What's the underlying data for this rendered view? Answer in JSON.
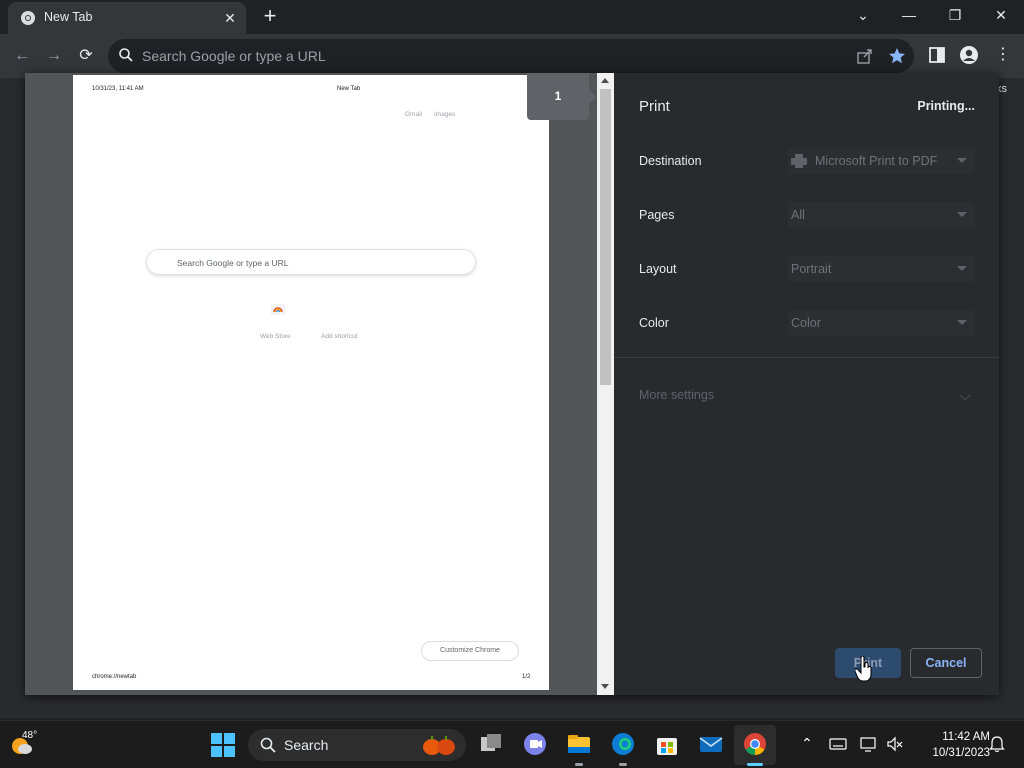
{
  "browser": {
    "tab": {
      "title": "New Tab"
    },
    "omnibox": {
      "placeholder": "Search Google or type a URL"
    },
    "bookmarks_tail": "ks"
  },
  "print_preview": {
    "page_number": "1",
    "header": {
      "datetime": "10/31/23, 11:41 AM",
      "title": "New Tab"
    },
    "links": [
      "Gmail",
      "Images"
    ],
    "search_placeholder": "Search Google or type a URL",
    "shortcuts": [
      "Web Store",
      "Add shortcut"
    ],
    "customize_label": "Customize Chrome",
    "footer": {
      "url": "chrome://newtab",
      "page": "1/2"
    }
  },
  "print_settings": {
    "title": "Print",
    "status": "Printing...",
    "rows": [
      {
        "label": "Destination",
        "value": "Microsoft Print to PDF"
      },
      {
        "label": "Pages",
        "value": "All"
      },
      {
        "label": "Layout",
        "value": "Portrait"
      },
      {
        "label": "Color",
        "value": "Color"
      }
    ],
    "more_settings": "More settings",
    "print_button": "Print",
    "cancel_button": "Cancel"
  },
  "taskbar": {
    "weather_temp": "48°",
    "search_label": "Search",
    "time": "11:42 AM",
    "date": "10/31/2023"
  },
  "colors": {
    "accent": "#8ab4f8",
    "dialog_bg": "#292a2d",
    "preview_bg": "#525659"
  }
}
